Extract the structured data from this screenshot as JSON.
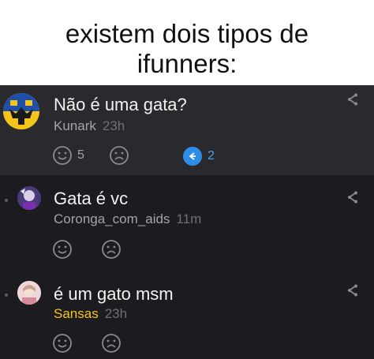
{
  "caption": {
    "line1": "existem dois tipos de",
    "line2": "ifunners:"
  },
  "comments": [
    {
      "text": "Não é uma gata?",
      "user": "Kunark",
      "time": "23h",
      "smile_count": "5",
      "reply_count": "2"
    },
    {
      "text": "Gata é vc",
      "user": "Coronga_com_aids",
      "time": "11m"
    },
    {
      "text": "é um gato msm",
      "user": "Sansas",
      "time": "23h"
    }
  ],
  "colors": {
    "username_highlight": "#f5c518",
    "reply_accent": "#2e8de6"
  }
}
